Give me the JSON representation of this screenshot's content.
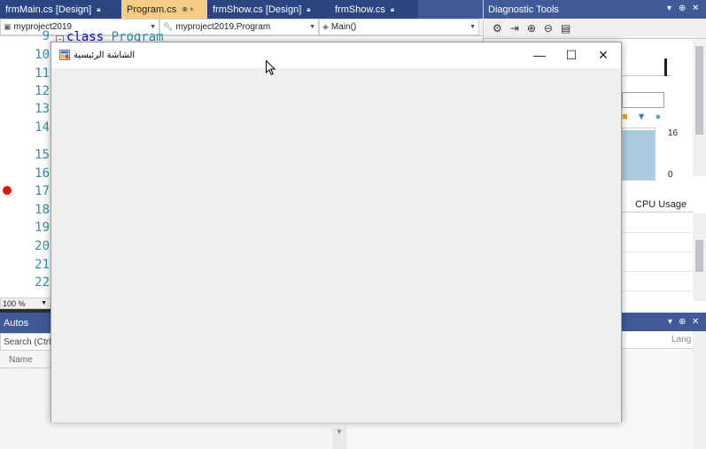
{
  "tabs": [
    {
      "label": "frmMain.cs [Design]",
      "pin": "🔒︎"
    },
    {
      "label": "Program.cs",
      "pin": "⊕ ×"
    },
    {
      "label": "frmShow.cs [Design]",
      "pin": "🔒︎"
    },
    {
      "label": "frmShow.cs",
      "pin": "🔒︎"
    }
  ],
  "navbar": {
    "project": "myproject2019",
    "class": "myproject2019.Program",
    "member": "Main()"
  },
  "editor": {
    "line_numbers": [
      "10",
      "11",
      "12",
      "13",
      "14",
      "15",
      "16",
      "17",
      "18",
      "19",
      "20",
      "21",
      "22"
    ],
    "peek_line": "9",
    "peek_code_keyword": "class",
    "peek_code_name": "Program",
    "zoom": "100 %"
  },
  "autos": {
    "title": "Autos",
    "search_placeholder": "Search (Ctrl+",
    "col_name": "Name"
  },
  "diagnostics": {
    "title": "Diagnostic Tools",
    "axis_top": "16",
    "axis_bottom": "0",
    "cpu_tab_partial": "e",
    "cpu_tab": "CPU Usage"
  },
  "bottom_right": {
    "lang_header": "Lang"
  },
  "window": {
    "caption": "الشاشة الرئيسية",
    "minimize": "—",
    "maximize": "☐",
    "close": "✕"
  },
  "colors": {
    "vs_blue": "#3f5a96",
    "active_tab": "#f5cc84",
    "breakpoint": "#e51400",
    "line_number": "#2b91af"
  }
}
